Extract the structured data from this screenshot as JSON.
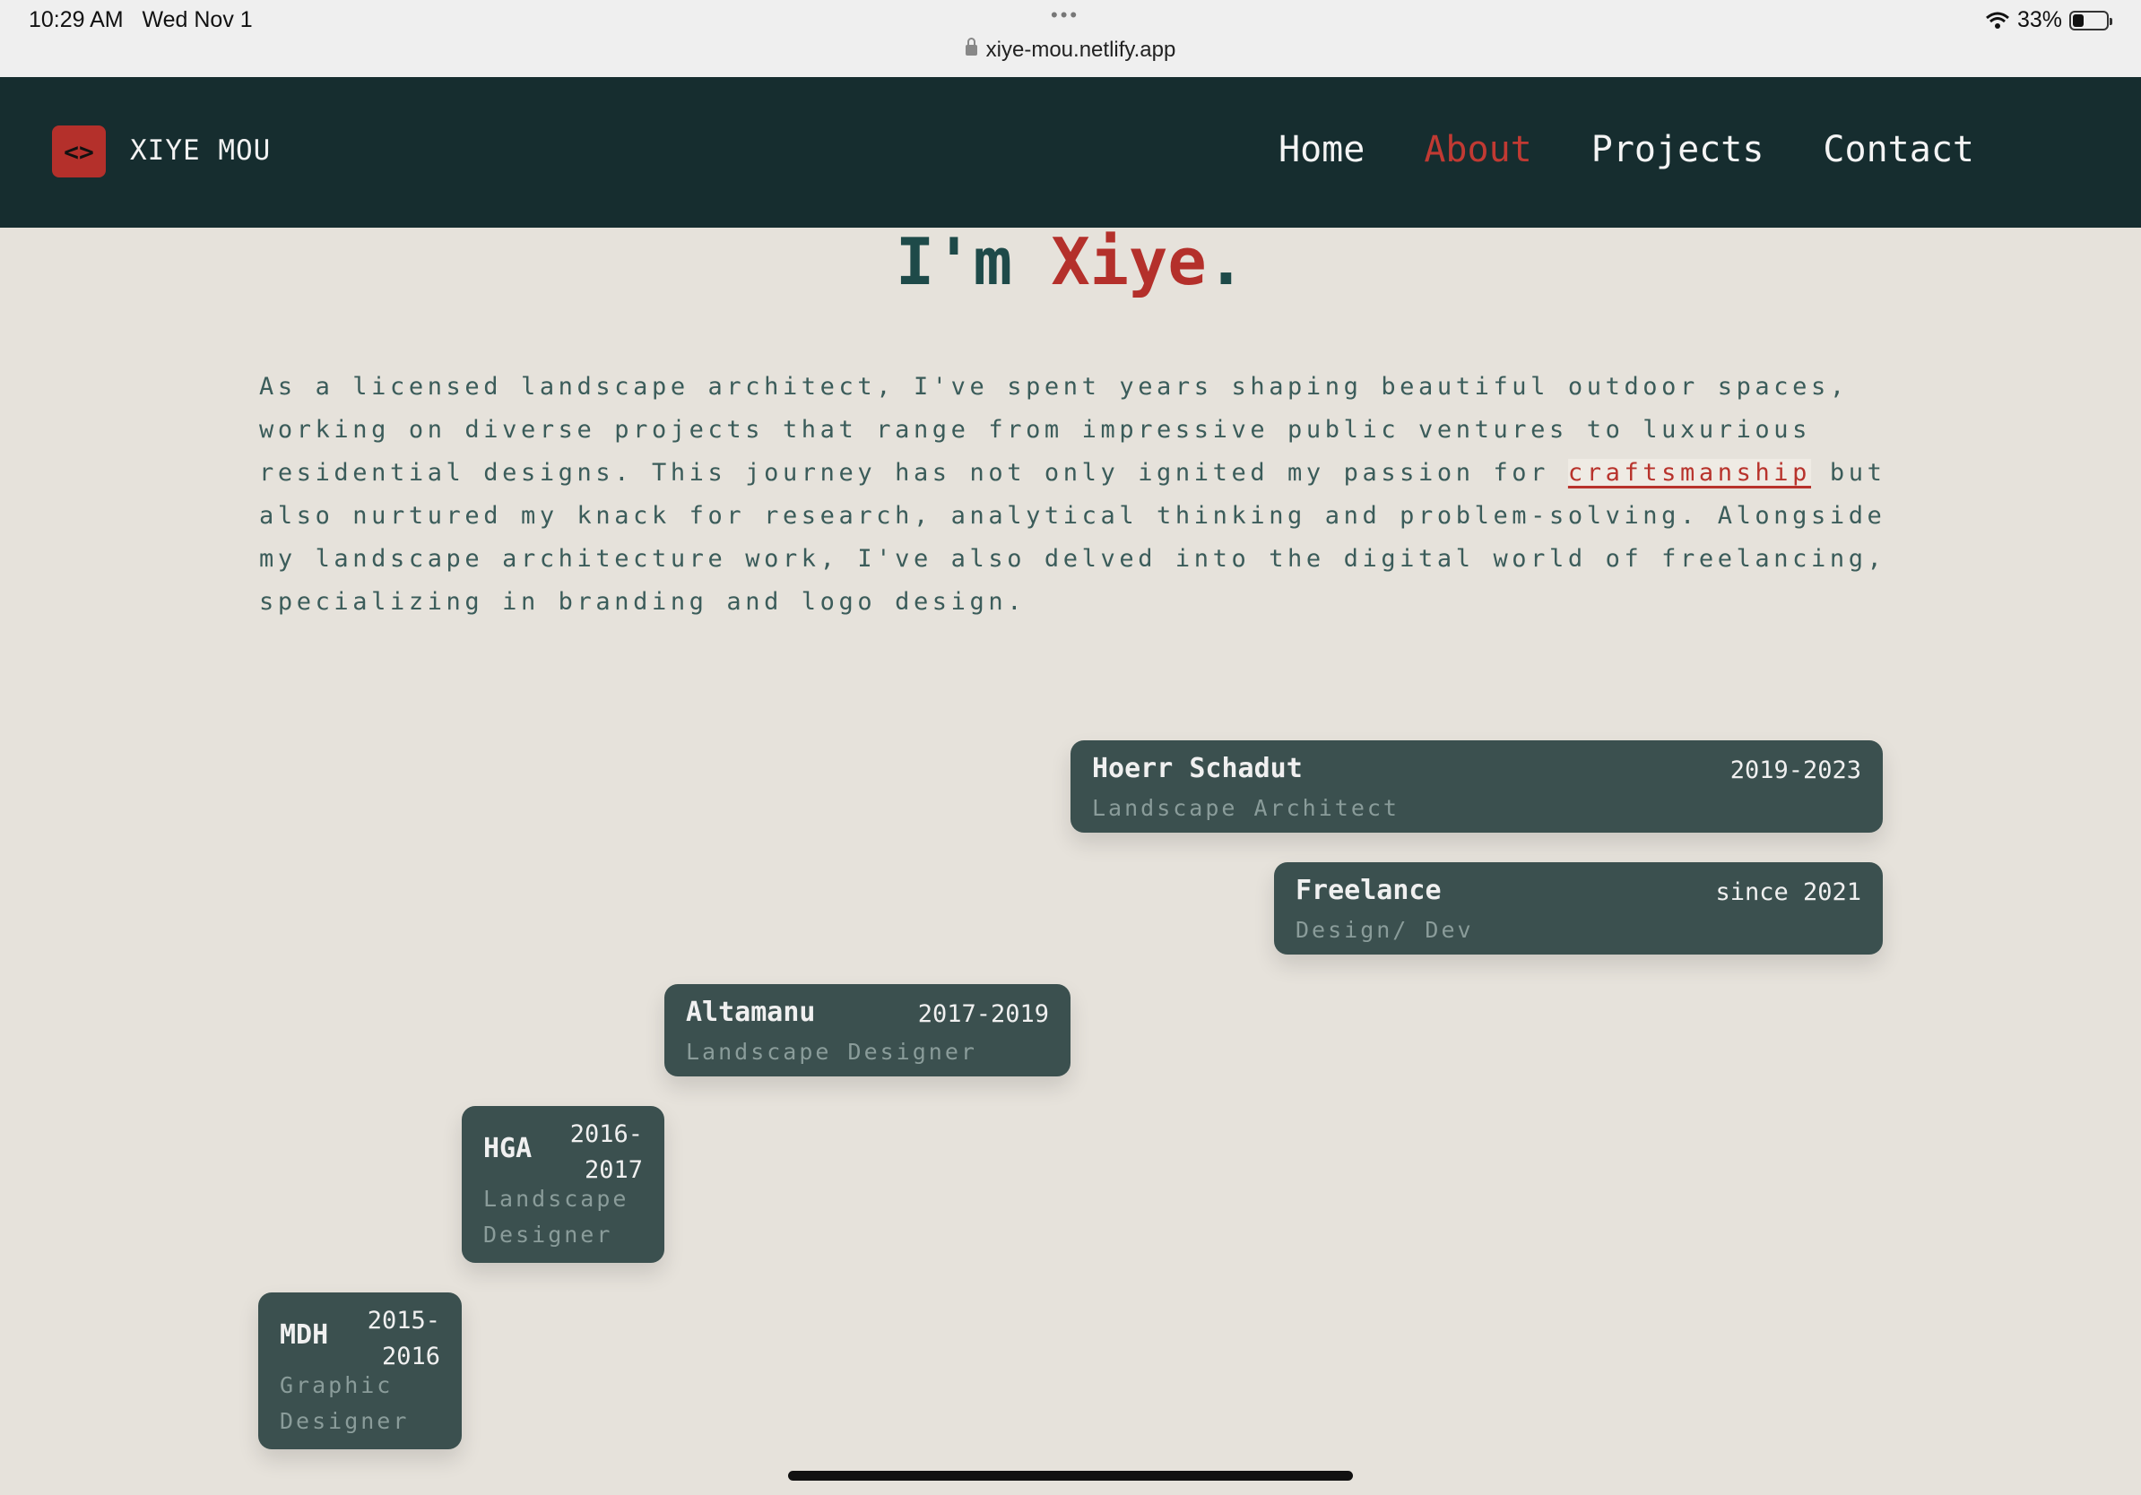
{
  "status_bar": {
    "time": "10:29 AM",
    "date": "Wed Nov 1",
    "url": "xiye-mou.netlify.app",
    "battery": "33%",
    "battery_level": 0.33
  },
  "nav": {
    "logo_icon": "code-brackets-icon",
    "logo_glyph": "<>",
    "logo_text": "XIYE MOU",
    "links": [
      "Home",
      "About",
      "Projects",
      "Contact"
    ],
    "active": "About"
  },
  "hero": {
    "prefix": "I'm ",
    "name": "Xiye",
    "suffix": "."
  },
  "about": {
    "text_before": "As a licensed landscape architect, I've spent years shaping beautiful outdoor spaces, working on diverse projects that range from impressive public ventures to luxurious residential designs. This journey has not only ignited my passion for ",
    "highlight": "craftsmanship",
    "text_after": " but also nurtured my knack for research, analytical thinking and problem-solving. Alongside my landscape architecture work, I've also delved into the digital world of freelancing, specializing in branding and logo design."
  },
  "timeline": [
    {
      "company": "Hoerr Schadut",
      "years": "2019-2023",
      "role": "Landscape Architect"
    },
    {
      "company": "Freelance",
      "years": "since 2021",
      "role": "Design/ Dev"
    },
    {
      "company": "Altamanu",
      "years": "2017-2019",
      "role": "Landscape Designer"
    },
    {
      "company": "HGA",
      "years": "2016-2017",
      "years_line1": "2016-",
      "years_line2": "2017",
      "role": "Landscape Designer",
      "role_line1": "Landscape",
      "role_line2": "Designer"
    },
    {
      "company": "MDH",
      "years": "2015-2016",
      "years_line1": "2015-",
      "years_line2": "2016",
      "role": "Graphic Designer",
      "role_line1": "Graphic",
      "role_line2": "Designer"
    }
  ],
  "colors": {
    "background": "#e6e2db",
    "nav_bg": "#162d2f",
    "accent": "#b4302b",
    "card_bg": "#3b504f",
    "text": "#3b5c5a"
  }
}
